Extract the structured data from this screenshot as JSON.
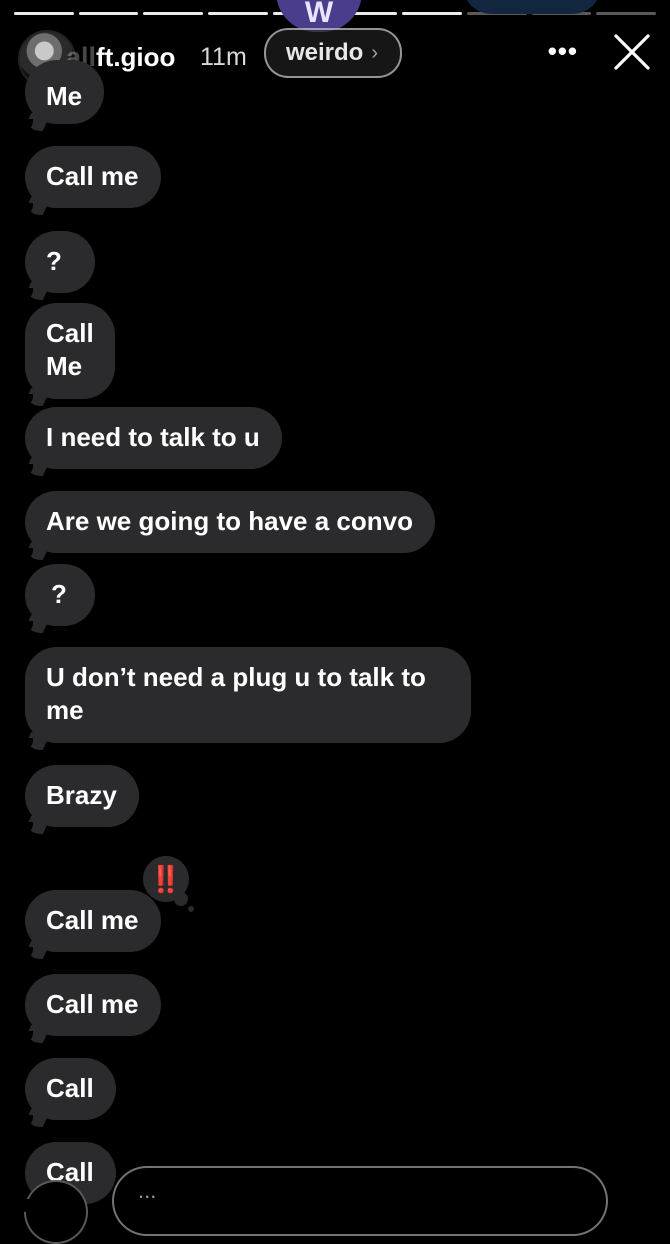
{
  "story": {
    "segments_total": 10,
    "segments_done": 7
  },
  "header": {
    "username": "ft.gioo",
    "time_ago": "11m",
    "ghost_text": "all",
    "pill_label": "weirdo",
    "pill_chevron": "›",
    "more_label": "•••",
    "close_icon": "close-icon",
    "peek_letter": "W"
  },
  "messages": [
    {
      "text": "Me",
      "wrap": false
    },
    {
      "text": "Call me",
      "wrap": false
    },
    {
      "text": "?",
      "wrap": false
    },
    {
      "text": "Call Me",
      "wrap": true
    },
    {
      "text": "I need to talk to u",
      "wrap": false
    },
    {
      "text": "Are we going to have a convo",
      "wrap": false
    },
    {
      "text": "?",
      "wrap": false
    },
    {
      "text": "U don’t need a plug u to talk to me",
      "wrap": true
    },
    {
      "text": "Brazy",
      "wrap": false
    },
    {
      "text": "Call me",
      "wrap": false
    },
    {
      "text": "Call me",
      "wrap": false
    },
    {
      "text": "Call",
      "wrap": false
    },
    {
      "text": "Call",
      "wrap": false
    }
  ],
  "reaction": {
    "emoji": "‼️"
  },
  "reply": {
    "placeholder": "..."
  },
  "colors": {
    "bubble": "#2b2b2d",
    "background": "#000000",
    "reaction": "#e23a3a"
  }
}
